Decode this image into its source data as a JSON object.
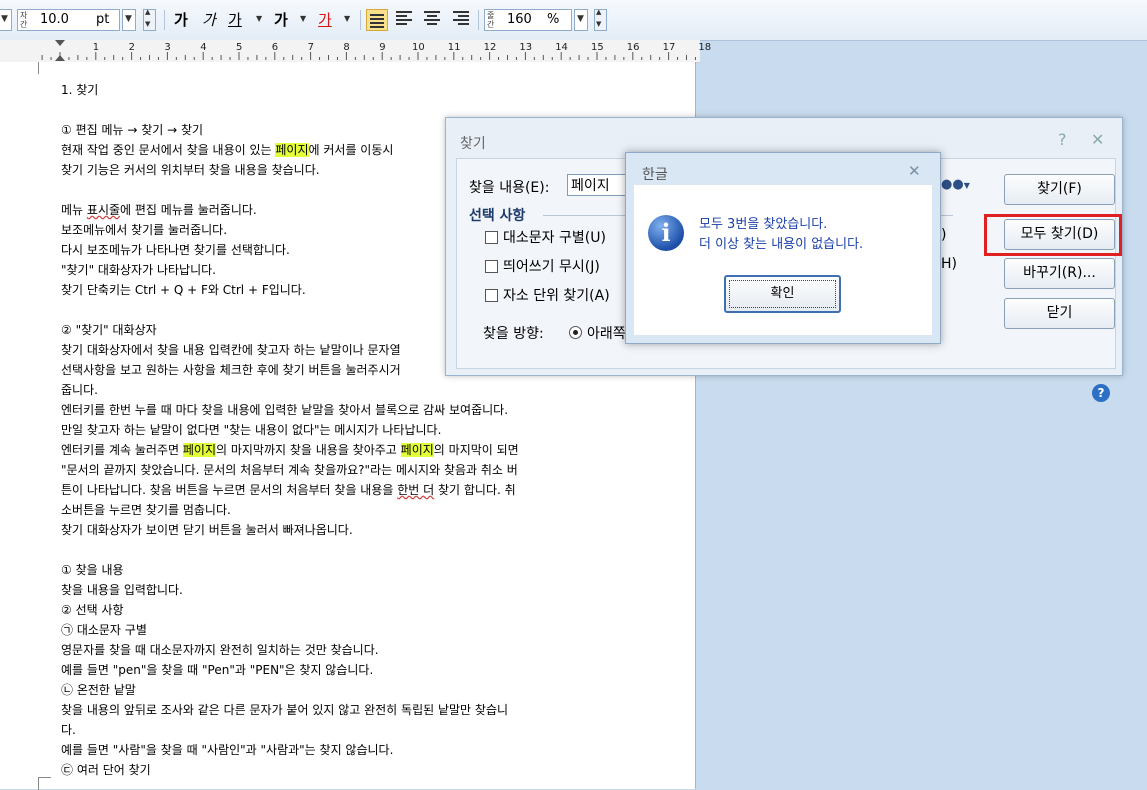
{
  "toolbar": {
    "line_spacing_icon_label": "자간",
    "font_size": "10.0",
    "font_unit": "pt",
    "bold_label": "가",
    "italic_label": "가",
    "underline_label": "가",
    "strike_label": "가",
    "color_label": "가",
    "spacing_icon_label": "줄간",
    "line_spacing": "160",
    "line_spacing_unit": "%"
  },
  "ruler": {
    "labels": [
      "1",
      "2",
      "3",
      "4",
      "5",
      "6",
      "7",
      "8",
      "9",
      "10",
      "11",
      "12",
      "13",
      "14",
      "15",
      "16",
      "17",
      "18"
    ]
  },
  "document": {
    "lines": [
      [
        {
          "t": "1. 찾기"
        }
      ],
      [
        {
          "t": ""
        }
      ],
      [
        {
          "t": "① 편집 메뉴 → 찾기 → 찾기"
        }
      ],
      [
        {
          "t": "현재 작업 중인 문서에서 찾을 내용이 있는 "
        },
        {
          "t": "페이지",
          "h": true
        },
        {
          "t": "에 커서를 이동시"
        }
      ],
      [
        {
          "t": "찾기 기능은 커서의 위치부터 찾을 내용을 찾습니다."
        }
      ],
      [
        {
          "t": ""
        }
      ],
      [
        {
          "t": "메뉴 "
        },
        {
          "t": "표시줄",
          "s": true
        },
        {
          "t": "에 편집 메뉴를 눌러줍니다."
        }
      ],
      [
        {
          "t": "보조메뉴에서 찾기를 눌러줍니다."
        }
      ],
      [
        {
          "t": "다시 보조메뉴가 나타나면 찾기를 선택합니다."
        }
      ],
      [
        {
          "t": "\"찾기\" 대화상자가 나타납니다."
        }
      ],
      [
        {
          "t": "찾기 단축키는 Ctrl + Q + F와 Ctrl + F입니다."
        }
      ],
      [
        {
          "t": ""
        }
      ],
      [
        {
          "t": "② \"찾기\" 대화상자"
        }
      ],
      [
        {
          "t": "찾기 대화상자에서 찾을 내용 입력칸에 찾고자 하는 낱말이나 문자열"
        }
      ],
      [
        {
          "t": "선택사항을 보고 원하는 사항을 체크한 후에 찾기 버튼을 눌러주시거"
        }
      ],
      [
        {
          "t": "줍니다."
        }
      ],
      [
        {
          "t": "엔터키를 한번 누를 때 마다 찾을 내용에 입력한 낱말을 찾아서 블록으로 감싸 보여줍니다."
        }
      ],
      [
        {
          "t": "만일 찾고자 하는 낱말이 없다면 \"찾는 내용이 없다\"는 메시지가 나타납니다."
        }
      ],
      [
        {
          "t": "엔터키를 계속 눌러주면 "
        },
        {
          "t": "페이지",
          "h": true
        },
        {
          "t": "의 마지막까지 찾을 내용을 찾아주고 "
        },
        {
          "t": "페이지",
          "h": true
        },
        {
          "t": "의 마지막이 되면"
        }
      ],
      [
        {
          "t": "\"문서의 끝까지 찾았습니다. 문서의 처음부터 계속 찾을까요?\"라는 메시지와 찾음과 취소 버"
        }
      ],
      [
        {
          "t": "튼이 나타납니다. 찾음 버튼을 누르면 문서의 처음부터 찾을 내용을 "
        },
        {
          "t": "한번 더",
          "s": true
        },
        {
          "t": " 찾기 합니다. 취"
        }
      ],
      [
        {
          "t": "소버튼을 누르면 찾기를 멈춥니다."
        }
      ],
      [
        {
          "t": "찾기 대화상자가 보이면 닫기 버튼을 눌러서 빠져나옵니다."
        }
      ],
      [
        {
          "t": ""
        }
      ],
      [
        {
          "t": "① 찾을 내용"
        }
      ],
      [
        {
          "t": "찾을 내용을 입력합니다."
        }
      ],
      [
        {
          "t": "② 선택 사항"
        }
      ],
      [
        {
          "t": "㉠ 대소문자 구별"
        }
      ],
      [
        {
          "t": "영문자를 찾을 때 대소문자까지 완전히 일치하는 것만 찾습니다."
        }
      ],
      [
        {
          "t": "예를 들면 \"pen\"을 찾을 때 \"Pen\"과 \"PEN\"은 찾지 않습니다."
        }
      ],
      [
        {
          "t": "㉡ 온전한 낱말"
        }
      ],
      [
        {
          "t": "찾을 내용의 앞뒤로 조사와 같은 다른 문자가 붙어 있지 않고 완전히 독립된 낱말만 찾습니"
        }
      ],
      [
        {
          "t": "다."
        }
      ],
      [
        {
          "t": "예를 들면 \"사람\"을 찾을 때 \"사람인\"과 \"사람과\"는 찾지 않습니다."
        }
      ],
      [
        {
          "t": "㉢ 여러 단어 찾기"
        }
      ]
    ]
  },
  "find_dialog": {
    "title": "찾기",
    "help_icon": "?",
    "close_icon": "✕",
    "find_label": "찾을 내용(E):",
    "find_value": "페이지",
    "options_title": "선택 사항",
    "opt_case": "대소문자 구별(U)",
    "opt_space": "띄어쓰기 무시(J)",
    "opt_jamo": "자소 단위 찾기(A)",
    "direction_label": "찾을 방향:",
    "direction_value": "아래쪽",
    "partial_right_1": ")",
    "partial_right_2": "H)",
    "btn_find": "찾기(F)",
    "btn_find_all": "모두 찾기(D)",
    "btn_replace": "바꾸기(R)...",
    "btn_close": "닫기",
    "help_button": "?"
  },
  "message_box": {
    "title": "한글",
    "close_icon": "✕",
    "line1": "모두 3번을 찾았습니다.",
    "line2": "더 이상 찾는 내용이 없습니다.",
    "ok_label": "확인",
    "info_icon_glyph": "i"
  }
}
